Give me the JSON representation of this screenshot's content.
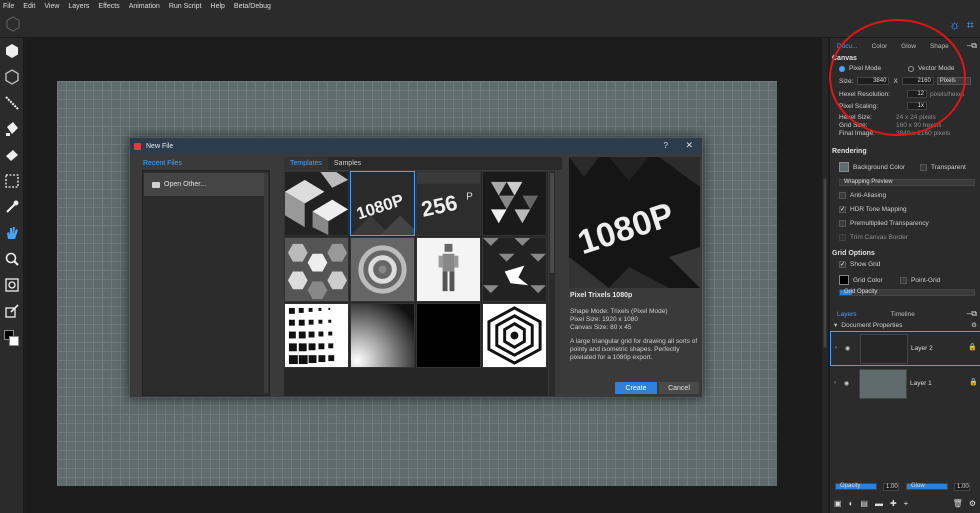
{
  "menubar": [
    "File",
    "Edit",
    "View",
    "Layers",
    "Effects",
    "Animation",
    "Run Script",
    "Help",
    "Beta/Debug"
  ],
  "toolbar_icons": [
    "hexagon-fill-icon",
    "hexagon-outline-icon",
    "line-icon",
    "bucket-icon",
    "eraser-icon",
    "select-icon",
    "eyedropper-icon",
    "hand-icon",
    "zoom-icon",
    "zoom-fit-icon",
    "export-icon"
  ],
  "dialog": {
    "title": "New File",
    "help": "?",
    "close": "✕",
    "recent_label": "Recent Files",
    "open_other": "Open Other...",
    "tabs": [
      "Templates",
      "Samples"
    ],
    "thumbnails": [
      "iso-blocks",
      "1080p",
      "256p",
      "triangles",
      "hexes",
      "spiral",
      "pixel-person",
      "houndstooth",
      "dot-gradient",
      "halftone",
      "black",
      "op-art"
    ],
    "preview_text": "1080P",
    "template_title": "Pixel Trixels 1080p",
    "shape_mode": "Shape Mode: Trixels (Pixel Mode)",
    "pixel_size": "Pixel Size: 1920 x 1080",
    "canvas_size": "Canvas Size: 80 x 45",
    "description": "A large triangular grid for drawing all sorts of pointy and isometric shapes. Perfectly pixelated for a 1080p export.",
    "create": "Create",
    "cancel": "Cancel"
  },
  "panel": {
    "tabs": [
      "Docu...",
      "Color",
      "Glow",
      "Shape"
    ],
    "canvas_head": "Canvas",
    "pixel_mode": "Pixel Mode",
    "vector_mode": "Vector Mode",
    "size_label": "Size:",
    "width": "3840",
    "x": "X",
    "height": "2160",
    "unit": "Pixels",
    "hexel_res_label": "Hexel Resolution:",
    "hexel_res": "12",
    "hexel_res_unit": "pixels/hexel",
    "pixel_scaling_label": "Pixel Scaling:",
    "pixel_scaling": "1x",
    "hexel_size_label": "Hexel Size:",
    "hexel_size": "24 x 24 pixels",
    "grid_size_label": "Grid Size:",
    "grid_size": "160 x 90 hexels",
    "final_image_label": "Final Image:",
    "final_image": "3840 x 2160 pixels",
    "rendering_head": "Rendering",
    "background_color": "Background Color",
    "transparent": "Transparent",
    "wrapping_preview": "Wrapping Preview",
    "anti_aliasing": "Anti-Aliasing",
    "hdr_tone": "HDR Tone Mapping",
    "premultiplied": "Premultiplied Transparency",
    "trim_canvas": "Trim Canvas Border",
    "grid_head": "Grid Options",
    "show_grid": "Show Grid",
    "grid_color": "Grid Color",
    "point_grid": "Point-Grid",
    "grid_opacity": "Grid Opacity",
    "layers_tab": "Layers",
    "timeline_tab": "Timeline",
    "doc_props": "Document Properties",
    "layer2": "Layer 2",
    "layer1": "Layer 1",
    "opacity_label": "Opacity",
    "opacity_val": "1.00",
    "glow_label": "Glow",
    "glow_val": "1.00"
  },
  "colors": {
    "accent": "#4aa3ff",
    "create_button": "#2f80d8",
    "annotation": "#e01515",
    "canvas_bg": "#5f6b6d"
  }
}
